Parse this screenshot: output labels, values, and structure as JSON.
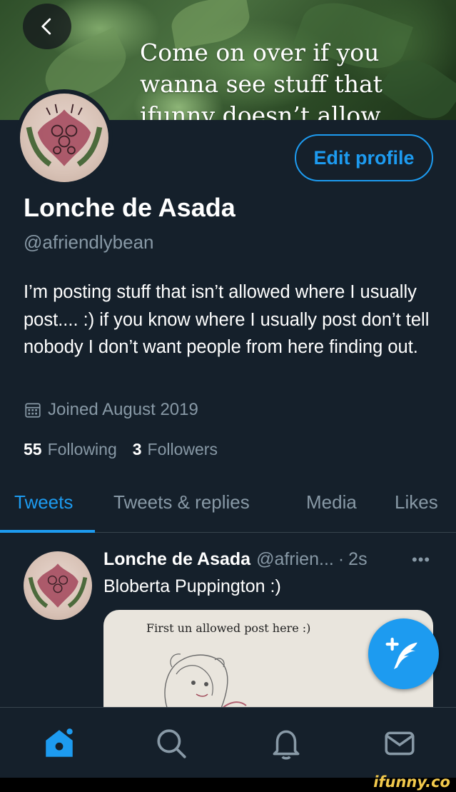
{
  "banner": {
    "text_lines": [
      "Come on over if you",
      "wanna see stuff that",
      "ifunny doesn’t allow"
    ]
  },
  "profile": {
    "name": "Lonche de Asada",
    "handle": "@afriendlybean",
    "edit_label": "Edit profile",
    "bio": "I’m posting stuff that isn’t allowed where I usually post.... :) if you know where I usually post don’t tell nobody I don’t want people from here finding out.",
    "joined": "Joined August 2019",
    "following_count": "55",
    "following_label": "Following",
    "followers_count": "3",
    "followers_label": "Followers"
  },
  "tabs": [
    {
      "label": "Tweets",
      "active": true
    },
    {
      "label": "Tweets & replies",
      "active": false
    },
    {
      "label": "Media",
      "active": false
    },
    {
      "label": "Likes",
      "active": false
    }
  ],
  "tweet": {
    "name": "Lonche de Asada",
    "handle": "@afrien...",
    "separator": "·",
    "time": "2s",
    "more": "•••",
    "text": "Bloberta Puppington :)",
    "media_caption": "First un allowed post here :)"
  },
  "icons": {
    "back": "chevron-left-icon",
    "calendar": "calendar-icon",
    "compose": "compose-tweet-icon",
    "home": "home-icon",
    "search": "search-icon",
    "notifications": "bell-icon",
    "messages": "mail-icon"
  },
  "colors": {
    "background": "#15202b",
    "accent": "#1d9bf0",
    "secondary_text": "#8899a6"
  },
  "watermark": "ifunny.co"
}
